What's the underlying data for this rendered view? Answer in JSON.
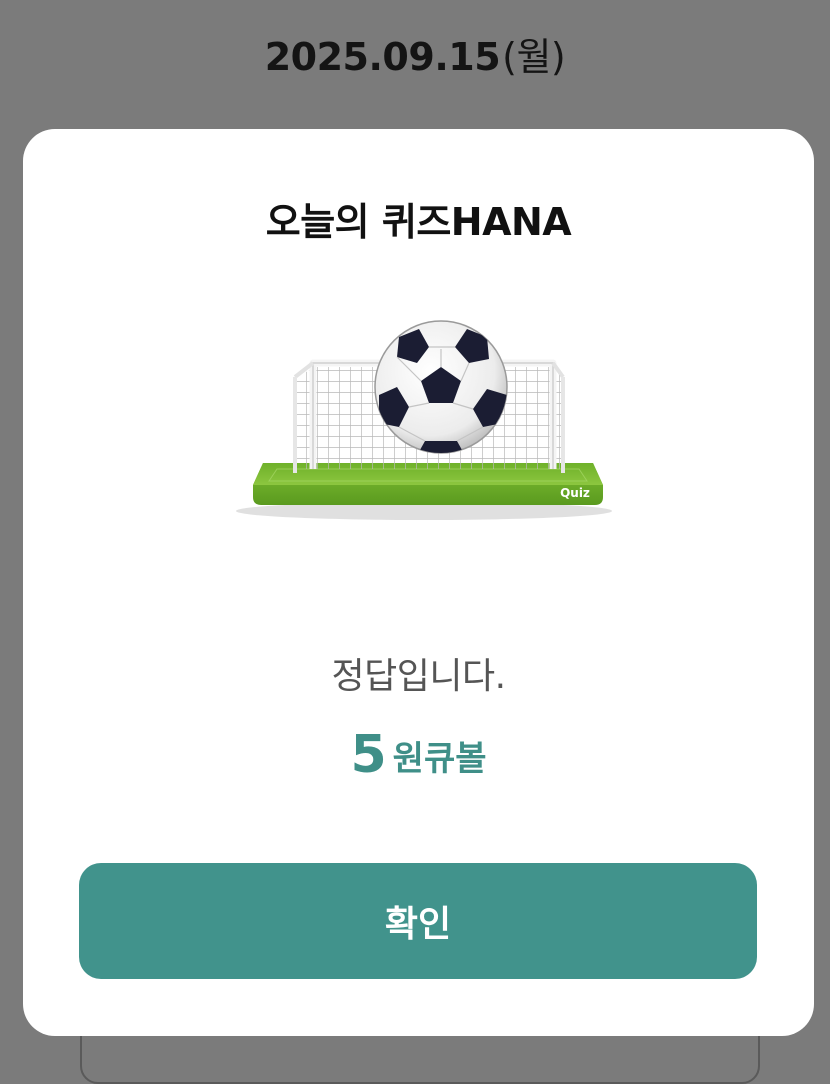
{
  "header": {
    "date": "2025.09.15",
    "weekday": "(월)"
  },
  "modal": {
    "title": "오늘의 퀴즈HANA",
    "illustration": {
      "icon": "soccer-goal-icon",
      "badge_text": "Quiz"
    },
    "message": "정답입니다.",
    "reward": {
      "amount": "5",
      "unit": "원큐볼"
    },
    "confirm_label": "확인"
  },
  "colors": {
    "accent": "#41938c",
    "reward_text": "#3f8f88",
    "overlay": "#7b7b7b",
    "field_green": "#7dbb2e"
  }
}
